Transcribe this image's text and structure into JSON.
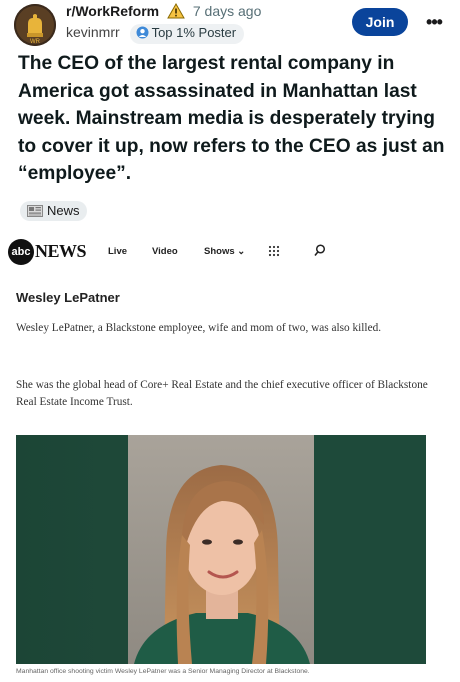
{
  "post": {
    "subreddit": "r/WorkReform",
    "time": "7 days ago",
    "username": "kevinmrr",
    "badge": "Top 1% Poster",
    "join_label": "Join",
    "more_label": "•••",
    "title": "The CEO of the largest rental company in America got assassinated in Manhattan last week. Mainstream media is desperately trying to cover it up, now refers to the CEO as just an “employee”.",
    "flair": "News"
  },
  "article": {
    "logo_circle": "abc",
    "logo_text": "NEWS",
    "nav": {
      "live": "Live",
      "video": "Video",
      "shows": "Shows ⌄"
    },
    "author": "Wesley LePatner",
    "paragraph1": "Wesley LePatner, a Blackstone employee, wife and mom of two, was also killed.",
    "paragraph2": "She was the global head of Core+ Real Estate and the chief executive officer of Blackstone Real Estate Income Trust.",
    "caption": "Manhattan office shooting victim Wesley LePatner was a Senior Managing Director at Blackstone."
  },
  "colors": {
    "join_button": "#0a449b",
    "photo_background": "#1f4b3a"
  },
  "icons": [
    "subreddit-avatar-icon",
    "warning-triangle-icon",
    "poster-badge-icon",
    "news-flair-icon",
    "grid-menu-icon",
    "search-icon"
  ]
}
